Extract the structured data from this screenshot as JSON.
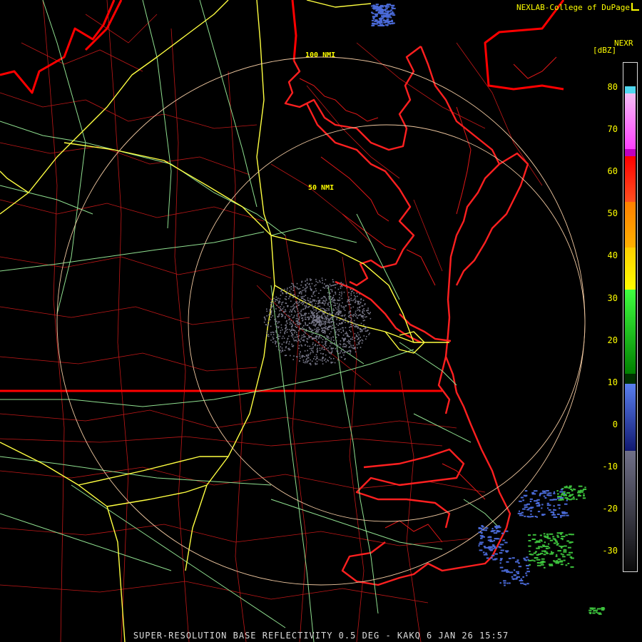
{
  "header": {
    "credit": "NEXLAB-College of DuPage"
  },
  "footer": {
    "product_line": "SUPER-RESOLUTION BASE REFLECTIVITY 0.5 DEG - KAKQ 6 JAN 26 15:57"
  },
  "legend": {
    "name": "NEXR",
    "unit": "[dBZ]",
    "ticks": [
      "80",
      "70",
      "60",
      "50",
      "40",
      "30",
      "20",
      "10",
      "0",
      "-10",
      "-20",
      "-30"
    ]
  },
  "range_rings": {
    "inner": "50 NMI",
    "outer": "100 NMI"
  },
  "colors": {
    "background": "#000000",
    "state_borders": "#ff0000",
    "coastline": "#ff2020",
    "county_lines": "#c01818",
    "interstates": "#ffff40",
    "highways": "#90e090",
    "range_rings": "#f0c8a0",
    "clutter_returns": "#7a7a8c",
    "light_echo": "#4a6ad8",
    "moderate_echo": "#3cc03c"
  },
  "icons": {
    "credit_logo": "corner-bracket-icon"
  }
}
